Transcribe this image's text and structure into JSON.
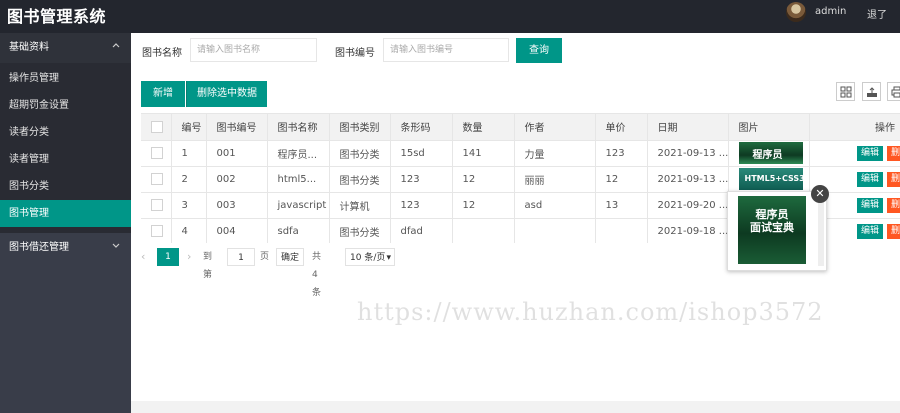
{
  "app": {
    "title": "图书管理系统",
    "user": "admin",
    "logout": "退了"
  },
  "sidebar": {
    "group1": {
      "label": "基础资料",
      "chevron": "chevron-up"
    },
    "items": [
      "操作员管理",
      "超期罚金设置",
      "读者分类",
      "读者管理",
      "图书分类",
      "图书管理"
    ],
    "active_index": 5,
    "group2": {
      "label": "图书借还管理",
      "chevron": "chevron-down"
    }
  },
  "search": {
    "name_label": "图书名称",
    "name_placeholder": "请输入图书名称",
    "code_label": "图书编号",
    "code_placeholder": "请输入图书编号",
    "query_button": "查询"
  },
  "toolbar": {
    "add_button": "新增",
    "delete_selected_button": "删除选中数据"
  },
  "table": {
    "headers": [
      "编号",
      "图书编号",
      "图书名称",
      "图书类别",
      "条形码",
      "数量",
      "作者",
      "单价",
      "日期",
      "图片",
      "操作"
    ],
    "rows": [
      [
        "1",
        "001",
        "程序员...",
        "图书分类",
        "15sd",
        "141",
        "力量",
        "123",
        "2021-09-13 ...",
        "程序员"
      ],
      [
        "2",
        "002",
        "html5...",
        "图书分类",
        "123",
        "12",
        "丽丽",
        "12",
        "2021-09-13 ...",
        "HTML5+CSS3"
      ],
      [
        "3",
        "003",
        "javascript",
        "计算机",
        "123",
        "12",
        "asd",
        "13",
        "2021-09-20 ...",
        ""
      ],
      [
        "4",
        "004",
        "sdfa",
        "图书分类",
        "dfad",
        "",
        "",
        "",
        "2021-09-18 ...",
        ""
      ]
    ],
    "edit_label": "编辑",
    "delete_label": "删除"
  },
  "pagination": {
    "current_page": "1",
    "goto_label": "到第",
    "page_input": "1",
    "page_unit": "页",
    "confirm": "确定",
    "total": "共 4 条",
    "page_size": "10 条/页"
  },
  "preview": {
    "title_line1": "程序员",
    "title_line2": "面试宝典"
  },
  "watermark": "https://www.huzhan.com/ishop3572"
}
